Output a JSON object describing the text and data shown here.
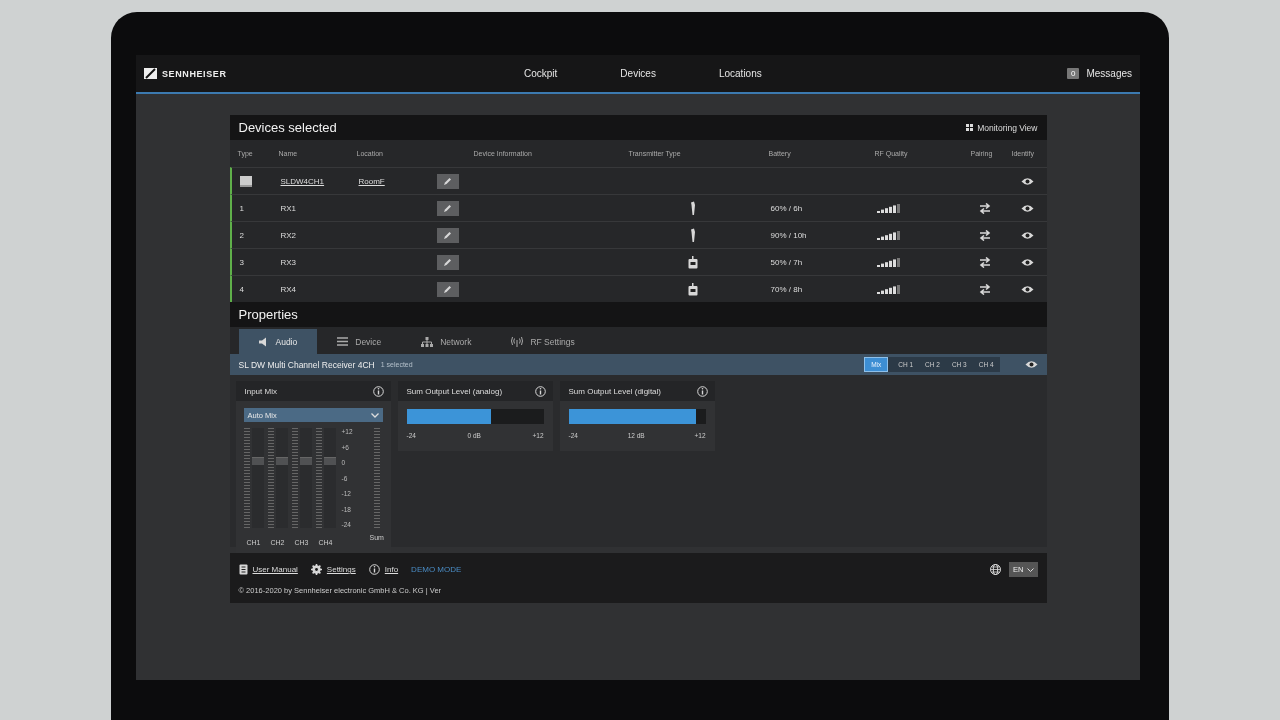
{
  "header": {
    "logo": "SENNHEISER",
    "nav": [
      {
        "label": "Cockpit"
      },
      {
        "label": "Devices"
      },
      {
        "label": "Locations"
      }
    ],
    "messages": {
      "count": "0",
      "label": "Messages"
    }
  },
  "devices": {
    "title": "Devices selected",
    "monitoring_view": "Monitoring View",
    "columns": [
      "Type",
      "Name",
      "Location",
      "Device Information",
      "Transmitter Type",
      "Battery",
      "RF Quality",
      "Pairing",
      "Identify"
    ],
    "rows": [
      {
        "kind": "device",
        "name": "SLDW4CH1",
        "location": "RoomF"
      },
      {
        "kind": "channel",
        "type": "1",
        "name": "RX1",
        "transmitter": {
          "kind": "handheld"
        },
        "battery": "60% / 6h"
      },
      {
        "kind": "channel",
        "type": "2",
        "name": "RX2",
        "transmitter": {
          "kind": "handheld"
        },
        "battery": "90% / 10h"
      },
      {
        "kind": "channel",
        "type": "3",
        "name": "RX3",
        "transmitter": {
          "kind": "bodypack"
        },
        "battery": "50% / 7h"
      },
      {
        "kind": "channel",
        "type": "4",
        "name": "RX4",
        "transmitter": {
          "kind": "bodypack"
        },
        "battery": "70% / 8h"
      }
    ]
  },
  "properties": {
    "title": "Properties",
    "tabs": [
      {
        "label": "Audio",
        "selected": true
      },
      {
        "label": "Device",
        "selected": false
      },
      {
        "label": "Network",
        "selected": false
      },
      {
        "label": "RF Settings",
        "selected": false
      }
    ],
    "device_bar": {
      "name": "SL DW Multi Channel Receiver 4CH",
      "count": "1 selected",
      "channels": [
        {
          "label": "Mix",
          "selected": true
        },
        {
          "label": "CH 1",
          "selected": false
        },
        {
          "label": "CH 2",
          "selected": false
        },
        {
          "label": "CH 3",
          "selected": false
        },
        {
          "label": "CH 4",
          "selected": false
        }
      ]
    },
    "input_mix": {
      "title": "Input Mix",
      "mode": "Auto Mix",
      "faders": [
        {
          "label": "CH1",
          "level": 0.67
        },
        {
          "label": "CH2",
          "level": 0.67
        },
        {
          "label": "CH3",
          "level": 0.67
        },
        {
          "label": "CH4",
          "level": 0.67
        }
      ],
      "scale": [
        "+12",
        "+6",
        "0",
        "-6",
        "-12",
        "-18",
        "-24"
      ],
      "sum_label": "Sum"
    },
    "outputs": [
      {
        "title": "Sum Output Level (analog)",
        "level": 0.62,
        "min": "-24",
        "reading": "0 dB",
        "max": "+12"
      },
      {
        "title": "Sum Output Level (digital)",
        "level": 0.93,
        "min": "-24",
        "reading": "12 dB",
        "max": "+12"
      }
    ]
  },
  "footer": {
    "links": [
      {
        "label": "User Manual"
      },
      {
        "label": "Settings"
      },
      {
        "label": "Info"
      }
    ],
    "demo": "DEMO MODE",
    "copyright": "© 2016-2020 by Sennheiser electronic GmbH & Co. KG | Ver",
    "language": "EN"
  }
}
